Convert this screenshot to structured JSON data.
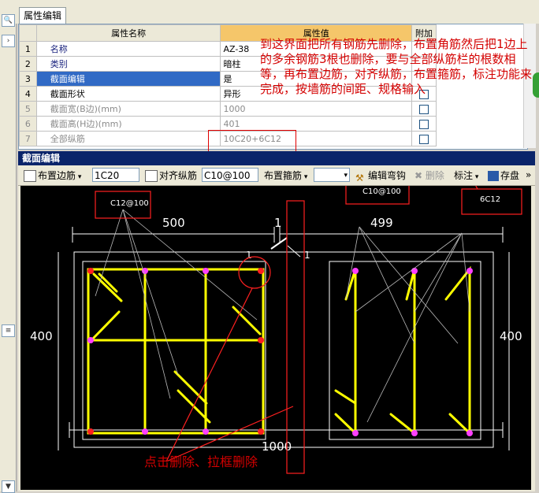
{
  "tab": {
    "label": "属性编辑"
  },
  "props": {
    "headers": {
      "name": "属性名称",
      "value": "属性值",
      "add": "附加"
    },
    "rows": [
      {
        "num": "1",
        "name": "名称",
        "value": "AZ-38"
      },
      {
        "num": "2",
        "name": "类别",
        "value": "暗柱"
      },
      {
        "num": "3",
        "name": "截面编辑",
        "value": "是"
      },
      {
        "num": "4",
        "name": "截面形状",
        "value": "异形"
      },
      {
        "num": "5",
        "name": "截面宽(B边)(mm)",
        "value": "1000"
      },
      {
        "num": "6",
        "name": "截面高(H边)(mm)",
        "value": "401"
      },
      {
        "num": "7",
        "name": "全部纵筋",
        "value": "10C20+6C12"
      }
    ]
  },
  "editor": {
    "title": "截面编辑",
    "toolbar": {
      "arrange_side": "布置边筋",
      "side_input": "1C20",
      "align": "对齐纵筋",
      "stirrup_input": "C10@100",
      "arrange_stirrup": "布置箍筋",
      "edit_hook": "编辑弯钩",
      "delete": "删除",
      "annotate": "标注",
      "save": "存盘"
    },
    "drawing": {
      "label_left_stirrup": "C12@100",
      "label_right_stirrup": "C10@100",
      "label_right_bars": "6C12",
      "dim_left_width": "500",
      "dim_right_width": "499",
      "dim_gap": "1",
      "dim_gap_left": "1",
      "dim_gap_right": "1",
      "dim_height_left": "400",
      "dim_height_right": "400",
      "dim_total": "1000"
    }
  },
  "annotation": {
    "main": "到这界面把所有钢筋先删除，布置角筋然后把1边上的多余钢筋3根也删除，要与全部纵筋栏的根数相等，再布置边筋，对齐纵筋，布置箍筋，标注功能来完成，按墙筋的间距、规格输入",
    "bottom": "点击删除、拉框删除"
  },
  "colors": {
    "rebar": "#ffff00",
    "corner_bar": "#ff2020",
    "side_bar": "#ff40ff",
    "dim": "#ffffff",
    "annotation": "#d40000",
    "canvas": "#000000"
  }
}
